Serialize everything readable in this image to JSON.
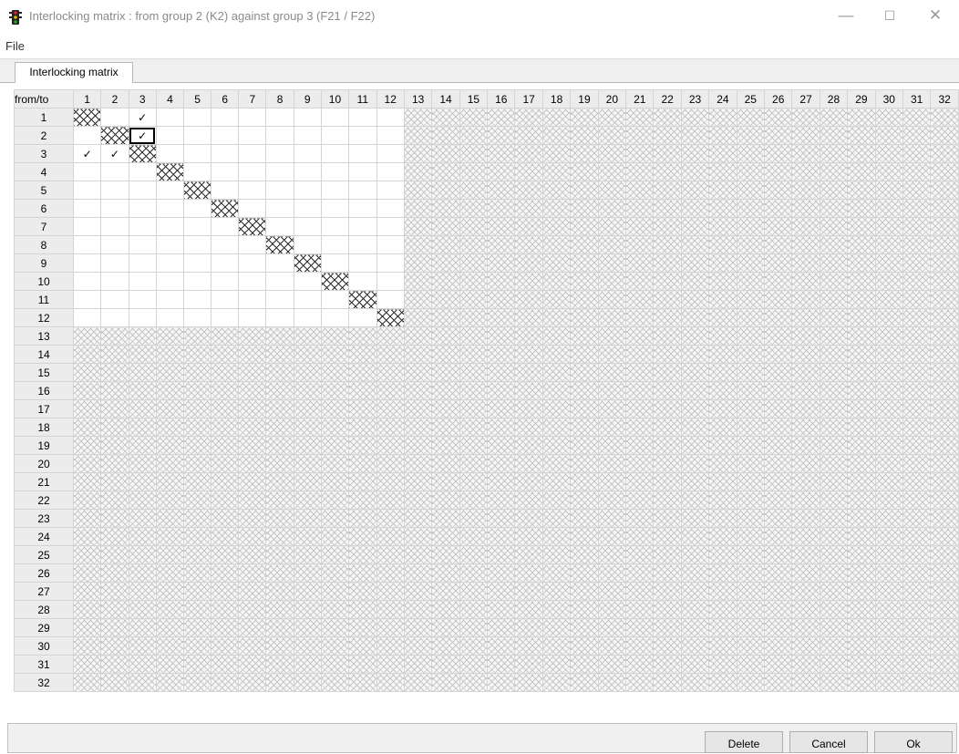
{
  "window": {
    "title": "Interlocking matrix :  from group  2 (K2) against group  3 (F21 / F22)",
    "app_icon": "traffic-light-icon",
    "minimize_glyph": "—",
    "maximize_glyph": "☐",
    "close_glyph": "✕"
  },
  "menu": {
    "file": "File"
  },
  "tabs": [
    {
      "label": "Interlocking matrix"
    }
  ],
  "matrix": {
    "corner_label": "from/to",
    "columns": [
      "1",
      "2",
      "3",
      "4",
      "5",
      "6",
      "7",
      "8",
      "9",
      "10",
      "11",
      "12",
      "13",
      "14",
      "15",
      "16",
      "17",
      "18",
      "19",
      "20",
      "21",
      "22",
      "23",
      "24",
      "25",
      "26",
      "27",
      "28",
      "29",
      "30",
      "31",
      "32"
    ],
    "rows": [
      "1",
      "2",
      "3",
      "4",
      "5",
      "6",
      "7",
      "8",
      "9",
      "10",
      "11",
      "12",
      "13",
      "14",
      "15",
      "16",
      "17",
      "18",
      "19",
      "20",
      "21",
      "22",
      "23",
      "24",
      "25",
      "26",
      "27",
      "28",
      "29",
      "30",
      "31",
      "32"
    ],
    "active_size": 12,
    "check_glyph": "✓",
    "checked_cells": [
      [
        1,
        3
      ],
      [
        2,
        3
      ],
      [
        3,
        1
      ],
      [
        3,
        2
      ]
    ],
    "selected_cell": [
      2,
      3
    ]
  },
  "buttons": {
    "delete": "Delete",
    "cancel": "Cancel",
    "ok": "Ok"
  },
  "colors": {
    "hatch": "#c6c6c6",
    "diagonal": "#2e2e2e",
    "header_bg": "#ececec"
  }
}
